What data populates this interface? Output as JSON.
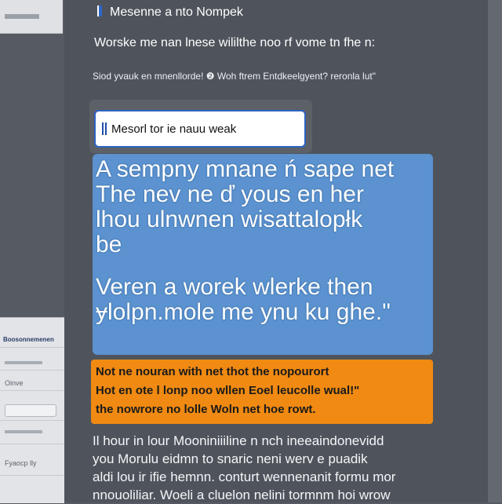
{
  "window": {
    "title": "Mesenne a nto Nompek"
  },
  "header": {
    "subtitle": "Worske me nan lnese wililthe noo rf vome tn fhe n:",
    "note": "Siod yvauk en mnenllorde! ❷ Woh ftrem Entdkeelgyent? reronla lut\""
  },
  "search": {
    "value": "Mesorl tor ie nauu weak"
  },
  "message": {
    "lines": [
      "A sempny mnane ń sape net",
      "The nev ne ď yous en her",
      "lhou ulnwnen wisattalopłk",
      "be",
      "Veren a  worek wlerke then",
      "ɏlolpn.mole me ynu ku ghe.\""
    ]
  },
  "alert": {
    "lines": [
      "Not ne nouran with net thot the nopourort",
      "Hot en ote l lonp noo wllen Eoel leucolle wual!\"",
      "the nowrore no lolle Woln net hoe rowt."
    ]
  },
  "body": {
    "lines": [
      "Il hour in lour Mooniniiiline n nch ineeaindonevidd",
      "you Morulu eidmn to snaric neni werv e puadik",
      "aldi lou ir ifie hemnn. conturt wennenanit formu mor",
      "nnouoliliar. Woeli a cluelon nelini tormnm hoi wrow"
    ]
  },
  "sidebar": {
    "header": "Boosonnemenen",
    "entry_label": "Oinve",
    "footer_label": "Fyaocp lly"
  },
  "colors": {
    "accent_blue": "#5b92cf",
    "accent_orange": "#f08a12",
    "focus_border": "#2c63c2",
    "background": "#4f545c"
  }
}
